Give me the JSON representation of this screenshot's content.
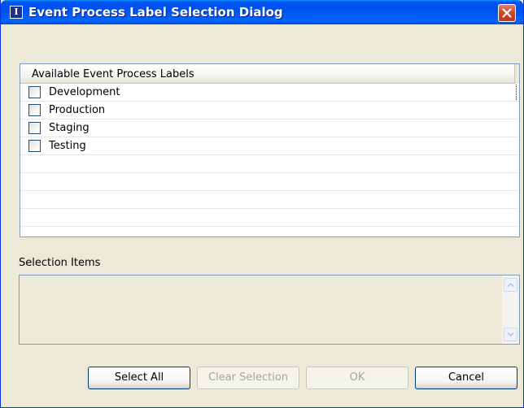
{
  "window": {
    "title": "Event Process Label Selection Dialog",
    "app_icon_glyph": "I"
  },
  "table": {
    "header": "Available Event Process Labels",
    "rows": [
      {
        "label": "Development",
        "checked": false
      },
      {
        "label": "Production",
        "checked": false
      },
      {
        "label": "Staging",
        "checked": false
      },
      {
        "label": "Testing",
        "checked": false
      }
    ]
  },
  "selection": {
    "label": "Selection Items"
  },
  "buttons": {
    "select_all": "Select All",
    "clear_selection": "Clear Selection",
    "ok": "OK",
    "cancel": "Cancel"
  },
  "colors": {
    "titlebar": "#0054e3",
    "close": "#d0482c",
    "dialog_bg": "#ece9d8",
    "border": "#7f9db9"
  }
}
